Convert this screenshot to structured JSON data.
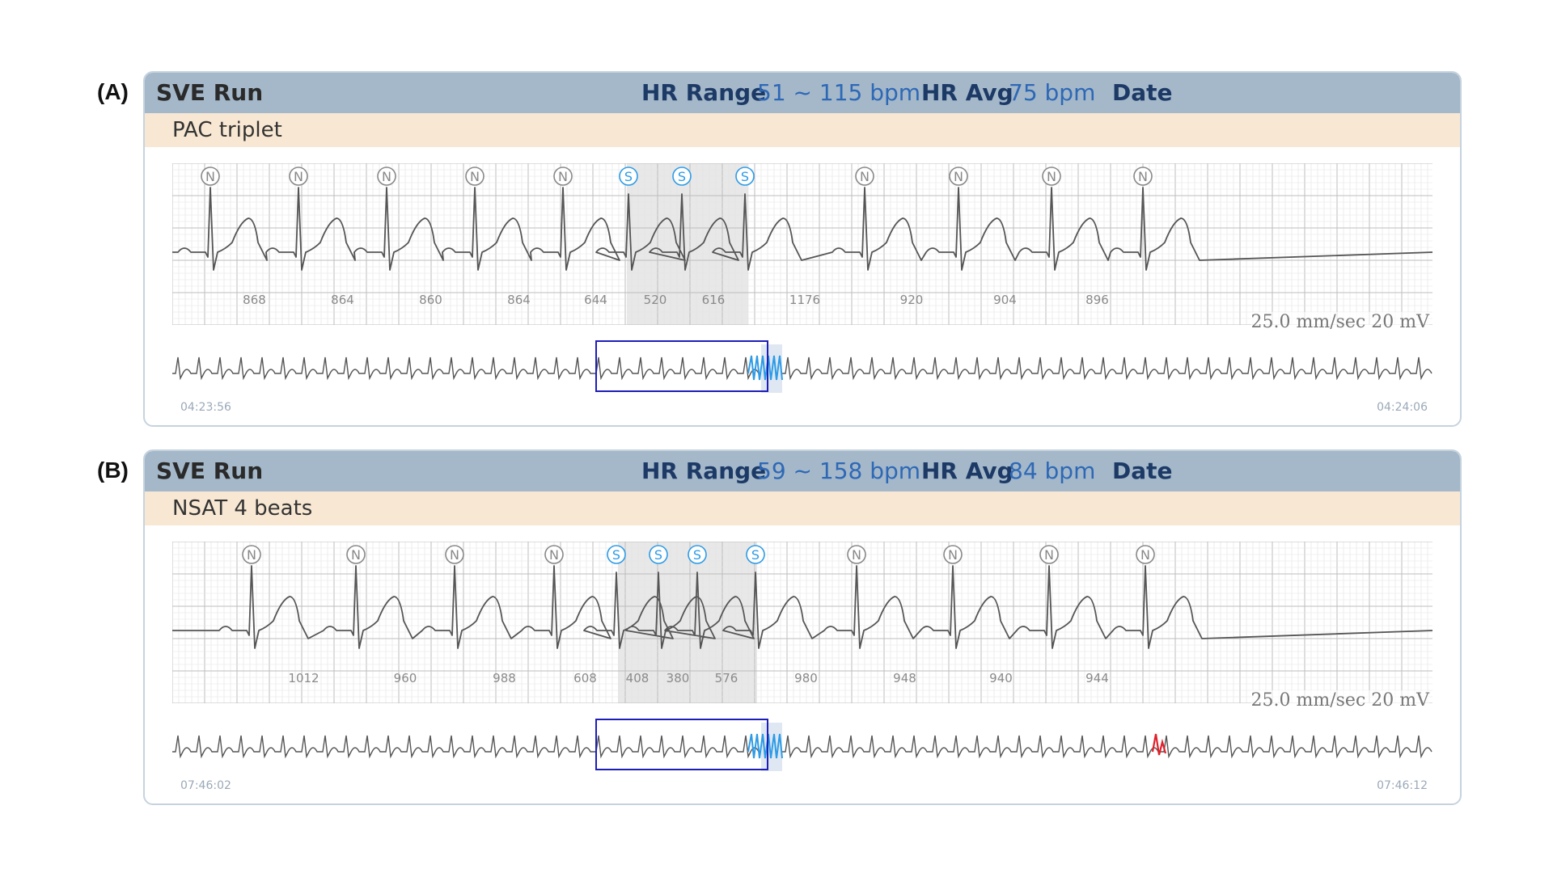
{
  "panels": [
    {
      "figure_label": "(A)",
      "title": "SVE Run",
      "hr_range_label": "HR Range",
      "hr_range_value": "51 ~ 115 bpm",
      "hr_avg_label": "HR Avg",
      "hr_avg_value": "75 bpm",
      "date_label": "Date",
      "subtitle": "PAC triplet",
      "scale": "25.0 mm/sec 20 mV",
      "time_start": "04:23:56",
      "time_end": "04:24:06",
      "beats": [
        "N",
        "N",
        "N",
        "N",
        "N",
        "S",
        "S",
        "S",
        "N",
        "N",
        "N",
        "N"
      ],
      "rr_intervals": [
        "868",
        "864",
        "860",
        "864",
        "644",
        "520",
        "616",
        "1176",
        "920",
        "904",
        "896"
      ]
    },
    {
      "figure_label": "(B)",
      "title": "SVE Run",
      "hr_range_label": "HR Range",
      "hr_range_value": "59 ~ 158 bpm",
      "hr_avg_label": "HR Avg",
      "hr_avg_value": "84 bpm",
      "date_label": "Date",
      "subtitle": "NSAT 4 beats",
      "scale": "25.0 mm/sec 20 mV",
      "time_start": "07:46:02",
      "time_end": "07:46:12",
      "beats": [
        "N",
        "N",
        "N",
        "N",
        "S",
        "S",
        "S",
        "S",
        "N",
        "N",
        "N",
        "N"
      ],
      "rr_intervals": [
        "1012",
        "960",
        "988",
        "608",
        "408",
        "380",
        "576",
        "980",
        "948",
        "940",
        "944"
      ]
    }
  ],
  "colors": {
    "header_bg": "#a4b8ca",
    "subtitle_bg": "#f8e8d3",
    "ecg_trace": "#555555",
    "s_beat": "#2d9be6",
    "n_beat": "#888888",
    "selection_box": "#1d1db8",
    "highlight_trace": "#2d9be6",
    "alert_trace": "#e0202a"
  }
}
